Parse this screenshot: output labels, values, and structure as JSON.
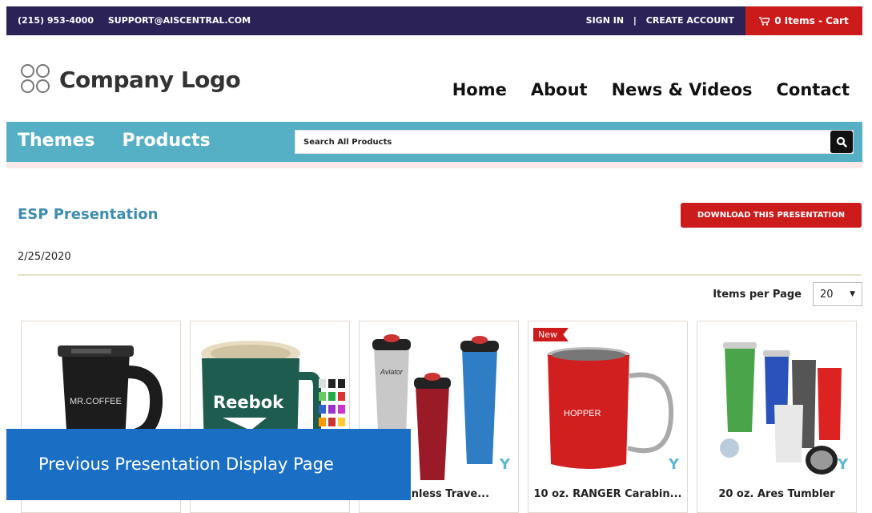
{
  "topbar": {
    "phone": "(215) 953-4000",
    "email": "SUPPORT@AISCENTRAL.COM",
    "sign_in": "SIGN IN",
    "separator": "|",
    "create_account": "CREATE ACCOUNT",
    "cart_label": "0 Items - Cart"
  },
  "logo": {
    "text": "Company Logo"
  },
  "nav": {
    "items": [
      "Home",
      "About",
      "News & Videos",
      "Contact"
    ]
  },
  "catbar": {
    "themes": "Themes",
    "products": "Products",
    "search_placeholder": "Search All Products"
  },
  "presentation": {
    "title": "ESP Presentation",
    "download_label": "DOWNLOAD THIS PRESENTATION",
    "date": "2/25/2020"
  },
  "paging": {
    "label": "Items per Page",
    "selected": "20"
  },
  "products": [
    {
      "name": "",
      "badge": ""
    },
    {
      "name": "",
      "badge": ""
    },
    {
      "name": "Stainless Trave...",
      "badge": ""
    },
    {
      "name": "10 oz. RANGER Carabin...",
      "badge": "New"
    },
    {
      "name": "20 oz. Ares Tumbler",
      "badge": ""
    }
  ],
  "product_images": {
    "p1_brand": "MR.COFFEE",
    "p2_brand": "Reebok",
    "p3_brand": "Aviator",
    "p4_brand": "HOPPER"
  },
  "overlay": {
    "text": "Previous Presentation Display Page"
  },
  "colors": {
    "topbar": "#2b2257",
    "accent_red": "#cc1b1b",
    "category_bar": "#55b0c6",
    "title_blue": "#3d8db0",
    "overlay_blue": "#1a6fc4"
  }
}
